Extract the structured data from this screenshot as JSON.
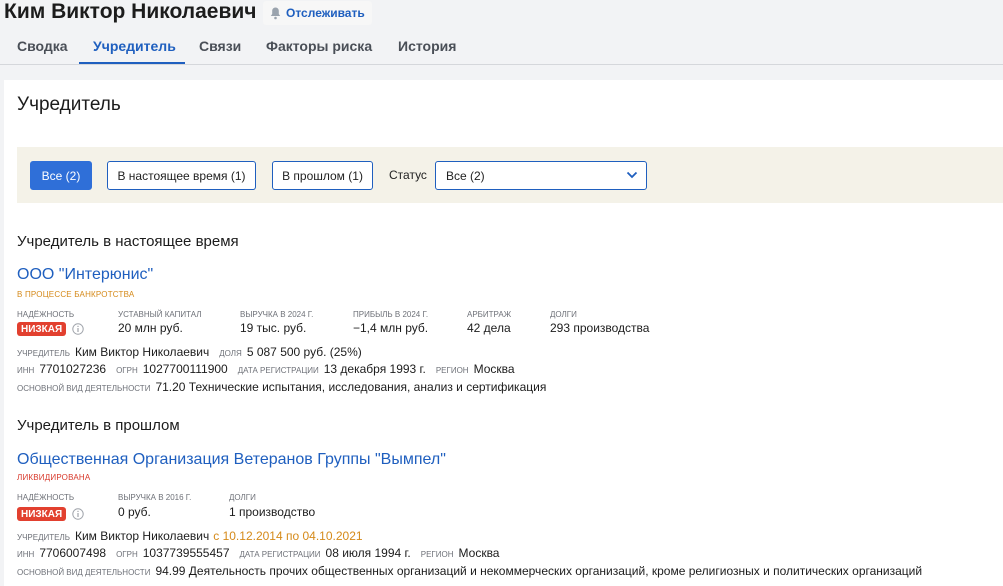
{
  "header": {
    "person_name": "Ким Виктор Николаевич",
    "follow_label": "Отслеживать"
  },
  "tabs": [
    {
      "label": "Сводка",
      "active": false
    },
    {
      "label": "Учредитель",
      "active": true
    },
    {
      "label": "Связи",
      "active": false
    },
    {
      "label": "Факторы риска",
      "active": false
    },
    {
      "label": "История",
      "active": false
    }
  ],
  "section_title": "Учредитель",
  "filters": {
    "all": "Все (2)",
    "current": "В настоящее время (1)",
    "past": "В прошлом (1)",
    "status_label": "Статус",
    "status_value": "Все (2)"
  },
  "current": {
    "title": "Учредитель в настоящее время",
    "org": {
      "name": "ООО \"Интерюнис\"",
      "status": "В ПРОЦЕССЕ БАНКРОТСТВА",
      "metrics": [
        {
          "label": "надёжность",
          "value": "Низкая"
        },
        {
          "label": "уставный капитал",
          "value": "20 млн руб."
        },
        {
          "label": "выручка в 2024 г.",
          "value": "19 тыс. руб."
        },
        {
          "label": "прибыль в 2024 г.",
          "value": "−1,4 млн руб."
        },
        {
          "label": "арбитраж",
          "value": "42 дела"
        },
        {
          "label": "долги",
          "value": "293 производства"
        }
      ],
      "founder_label": "учредитель",
      "founder": "Ким Виктор Николаевич",
      "share_label": "доля",
      "share": "5 087 500 руб. (25%)",
      "inn_label": "инн",
      "inn": "7701027236",
      "ogrn_label": "огрн",
      "ogrn": "1027700111900",
      "regdate_label": "дата регистрации",
      "regdate": "13 декабря 1993 г.",
      "region_label": "регион",
      "region": "Москва",
      "activity_label": "основной вид деятельности",
      "activity": "71.20 Технические испытания, исследования, анализ и сертификация"
    }
  },
  "past": {
    "title": "Учредитель в прошлом",
    "org": {
      "name": "Общественная Организация Ветеранов Группы \"Вымпел\"",
      "status": "ЛИКВИДИРОВАНА",
      "metrics": [
        {
          "label": "надёжность",
          "value": "Низкая"
        },
        {
          "label": "выручка в 2016 г.",
          "value": "0 руб."
        },
        {
          "label": "долги",
          "value": "1 производство"
        }
      ],
      "founder_label": "учредитель",
      "founder": "Ким Виктор Николаевич",
      "dates": "с 10.12.2014 по 04.10.2021",
      "inn_label": "инн",
      "inn": "7706007498",
      "ogrn_label": "огрн",
      "ogrn": "1037739555457",
      "regdate_label": "дата регистрации",
      "regdate": "08 июля 1994 г.",
      "region_label": "регион",
      "region": "Москва",
      "activity_label": "основной вид деятельности",
      "activity": "94.99 Деятельность прочих общественных организаций и некоммерческих организаций, кроме религиозных и политических организаций"
    }
  },
  "colors": {
    "accent": "#1f5fbf",
    "danger": "#e2402f",
    "warning": "#d58a1a",
    "filter_bg": "#f4f2e8"
  },
  "icons": [
    "bell-icon",
    "info-icon",
    "chevron-down-icon"
  ]
}
